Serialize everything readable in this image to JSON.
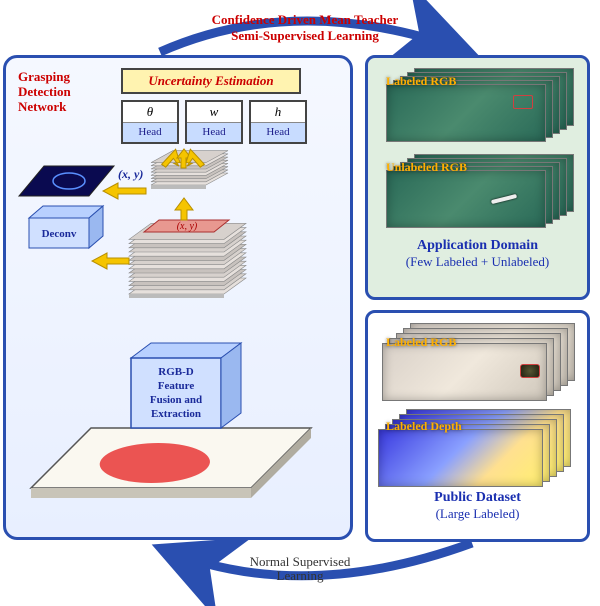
{
  "top_title_l1": "Confidence Driven Mean Teacher",
  "top_title_l2": "Semi-Supervised Learning",
  "bottom_title_l1": "Normal Supervised",
  "bottom_title_l2": "Learning",
  "left": {
    "network_label_l1": "Grasping",
    "network_label_l2": "Detection",
    "network_label_l3": "Network",
    "uncertainty": "Uncertainty Estimation",
    "heads": [
      {
        "var": "θ",
        "label": "Head"
      },
      {
        "var": "w",
        "label": "Head"
      },
      {
        "var": "h",
        "label": "Head"
      }
    ],
    "xy_label": "(x, y)",
    "xy_center": "(x, y)",
    "deconv": "Deconv",
    "rgbd_l1": "RGB-D",
    "rgbd_l2": "Feature",
    "rgbd_l3": "Fusion and",
    "rgbd_l4": "Extraction"
  },
  "app": {
    "stack1_label": "Labeled RGB",
    "stack2_label": "Unlabeled RGB",
    "title": "Application Domain",
    "subtitle": "(Few Labeled + Unlabeled)"
  },
  "pub": {
    "rgb_label": "Labeled RGB",
    "depth_label": "Labeled Depth",
    "title": "Public Dataset",
    "subtitle": "(Large Labeled)"
  }
}
